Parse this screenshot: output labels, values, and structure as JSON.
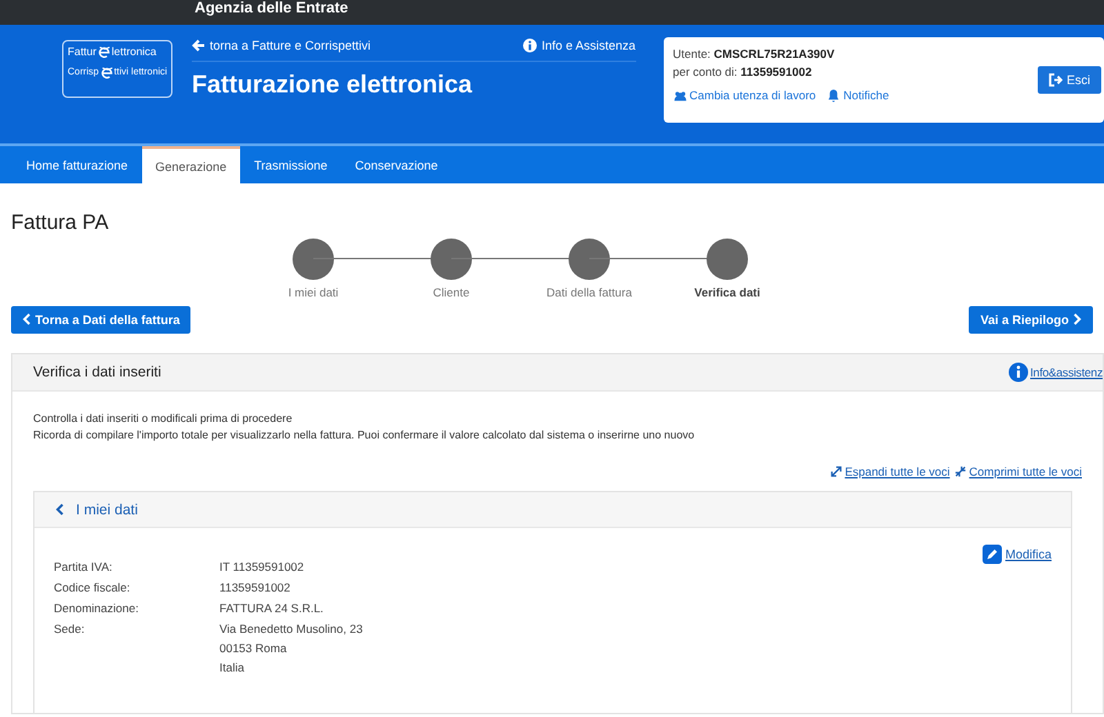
{
  "top_bar": {
    "title": "Agenzia delle Entrate"
  },
  "header": {
    "logo": [
      {
        "before": "Fattur",
        "after": "lettronica"
      },
      {
        "before": "Corrisp",
        "after": "ttivi lettronici"
      }
    ],
    "back_link": "torna a Fatture e Corrispettivi",
    "info_link": "Info e Assistenza",
    "title": "Fatturazione elettronica"
  },
  "user_box": {
    "user_label": "Utente:",
    "user": "CMSCRL75R21A390V",
    "account_label": "per conto di:",
    "account": "11359591002",
    "links": [
      {
        "kind": "users",
        "label": "Cambia utenza di lavoro"
      },
      {
        "kind": "bell",
        "label": "Notifiche"
      }
    ],
    "logout": "Esci"
  },
  "tabs": [
    {
      "label": "Home fatturazione",
      "selected": false
    },
    {
      "label": "Generazione",
      "selected": true
    },
    {
      "label": "Trasmissione",
      "selected": false
    },
    {
      "label": "Conservazione",
      "selected": false
    }
  ],
  "page_title": "Fattura PA",
  "steps": [
    {
      "label": "I miei dati",
      "selected": false
    },
    {
      "label": "Cliente",
      "selected": false
    },
    {
      "label": "Dati della fattura",
      "selected": false
    },
    {
      "label": "Verifica dati",
      "selected": true
    }
  ],
  "back_button": "Torna a Dati della fattura",
  "next_button": "Vai a Riepilogo",
  "panel": {
    "title": "Verifica i dati inseriti",
    "info_link": "Info&assistenz",
    "lines": [
      "Controlla i dati inseriti o modificali prima di procedere",
      "Ricorda di compilare l'importo totale per visualizzarlo nella fattura. Puoi confermare il valore calcolato dal sistema o inserirne uno nuovo"
    ],
    "expand": "Espandi tutte le voci",
    "collapse": "Comprimi tutte le voci"
  },
  "section": {
    "title": "I miei dati",
    "edit": "Modifica",
    "fields": [
      {
        "label": "Partita IVA:",
        "values": [
          "IT 11359591002"
        ]
      },
      {
        "label": "Codice fiscale:",
        "values": [
          "11359591002"
        ]
      },
      {
        "label": "Denominazione:",
        "values": [
          "FATTURA 24 S.R.L."
        ]
      },
      {
        "label": "Sede:",
        "values": [
          "Via Benedetto Musolino, 23",
          "00153 Roma",
          "Italia"
        ]
      }
    ]
  }
}
